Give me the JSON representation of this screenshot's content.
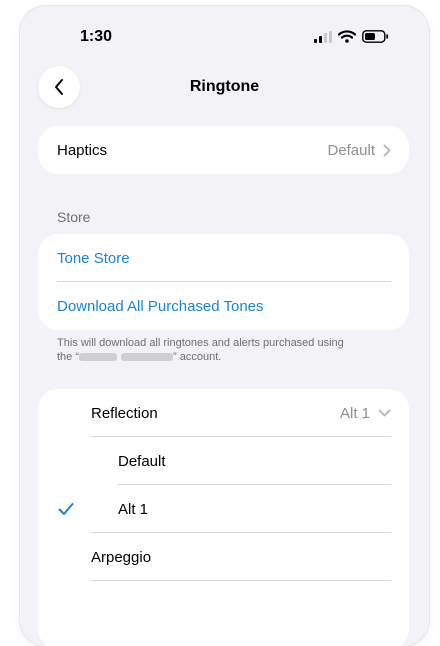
{
  "status_bar": {
    "time": "1:30",
    "icons": [
      "cellular-signal-icon",
      "wifi-icon",
      "battery-icon"
    ]
  },
  "nav": {
    "back_icon": "chevron-left-icon",
    "title": "Ringtone"
  },
  "haptics": {
    "label": "Haptics",
    "value": "Default"
  },
  "store": {
    "header": "Store",
    "items": [
      {
        "label": "Tone Store"
      },
      {
        "label": "Download All Purchased Tones"
      }
    ],
    "footnote_line1": "This will download all ringtones and alerts purchased using",
    "footnote_prefix": "the “",
    "footnote_suffix": "” account."
  },
  "tones": {
    "selected_group": {
      "label": "Reflection",
      "value": "Alt 1"
    },
    "items": [
      {
        "label": "Default",
        "checked": false
      },
      {
        "label": "Alt 1",
        "checked": true
      },
      {
        "label": "Arpeggio",
        "checked": false
      }
    ]
  },
  "colors": {
    "accent": "#1a84d8",
    "background": "#f2f2f7",
    "secondary_text": "#8e8e93"
  }
}
